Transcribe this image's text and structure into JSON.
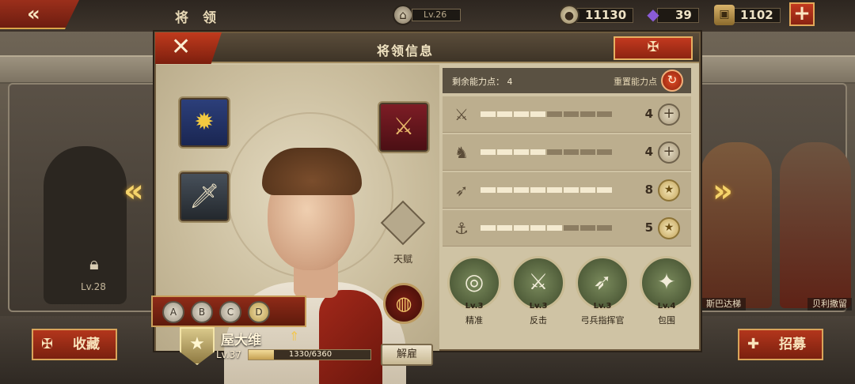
{
  "top_bar": {
    "back_icon": "double-chevron-left-icon",
    "title": "将 领",
    "level": "Lv.26",
    "resources": [
      {
        "name": "coin",
        "icon": "coin-icon",
        "value": "11130"
      },
      {
        "name": "gem",
        "icon": "purple-gem-icon",
        "value": "39"
      },
      {
        "name": "supply",
        "icon": "supply-crate-icon",
        "value": "1102"
      }
    ],
    "add_label": "+"
  },
  "left_card": {
    "lock_level": "Lv.28"
  },
  "right_cards": [
    {
      "name": "斯巴达梯"
    },
    {
      "name": "贝利撒留"
    }
  ],
  "bottom": {
    "favorite_label": "收藏",
    "recruit_label": "招募"
  },
  "panel": {
    "title": "将领信息",
    "close_label": "✕",
    "talent_label": "天赋",
    "hero": {
      "name": "屋大维",
      "level": "Lv.37",
      "xp_text": "1330/6360",
      "xp_fraction": 0.209
    },
    "dismiss_label": "解雇",
    "badges": [
      "A",
      "B",
      "C",
      "D"
    ],
    "stats": {
      "remaining_label": "剩余能力点：",
      "remaining_value": "4",
      "reset_label": "重置能力点",
      "rows": [
        {
          "icon": "sword-stat-icon",
          "glyph": "⚔",
          "value": "4",
          "filled": 4,
          "total": 8,
          "action": "plus"
        },
        {
          "icon": "horse-stat-icon",
          "glyph": "♞",
          "value": "4",
          "filled": 4,
          "total": 8,
          "action": "plus"
        },
        {
          "icon": "bow-stat-icon",
          "glyph": "➶",
          "value": "8",
          "filled": 8,
          "total": 8,
          "action": "max"
        },
        {
          "icon": "anchor-stat-icon",
          "glyph": "⚓",
          "value": "5",
          "filled": 5,
          "total": 8,
          "action": "max"
        }
      ]
    },
    "skills": [
      {
        "level": "Lv.3",
        "name": "精准",
        "glyph": "◎"
      },
      {
        "level": "Lv.3",
        "name": "反击",
        "glyph": "⚔"
      },
      {
        "level": "Lv.3",
        "name": "弓兵指挥官",
        "glyph": "➶"
      },
      {
        "level": "Lv.4",
        "name": "包围",
        "glyph": "✦"
      }
    ]
  }
}
